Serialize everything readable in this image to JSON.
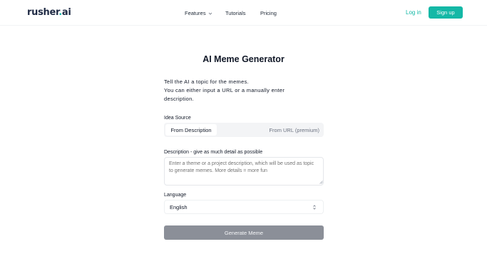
{
  "header": {
    "logo_main": "rusher",
    "logo_dot": ".",
    "logo_suffix": "ai",
    "nav": {
      "features": "Features",
      "tutorials": "Tutorials",
      "pricing": "Pricing"
    },
    "login": "Log in",
    "signup": "Sign up"
  },
  "main": {
    "title": "AI Meme Generator",
    "intro_line1": "Tell the AI a topic for the memes.",
    "intro_line2": "You can either input a URL or a manually enter description.",
    "idea_source_label": "Idea Source",
    "source_options": {
      "description": "From Description",
      "url": "From URL (premium)"
    },
    "description_label": "Description - give as much detail as possible",
    "description_placeholder": "Enter a theme or a project description, which will be used as topic to generate memes. More details = more fun",
    "language_label": "Language",
    "language_value": "English",
    "generate_button": "Generate Meme"
  },
  "colors": {
    "accent": "#14b8a6",
    "button_disabled": "#8b8f98"
  },
  "icons": {
    "features_dropdown": "chevron-down-icon",
    "select_arrows": "chevron-up-down-icon",
    "textarea_resize": "resize-handle-icon"
  }
}
